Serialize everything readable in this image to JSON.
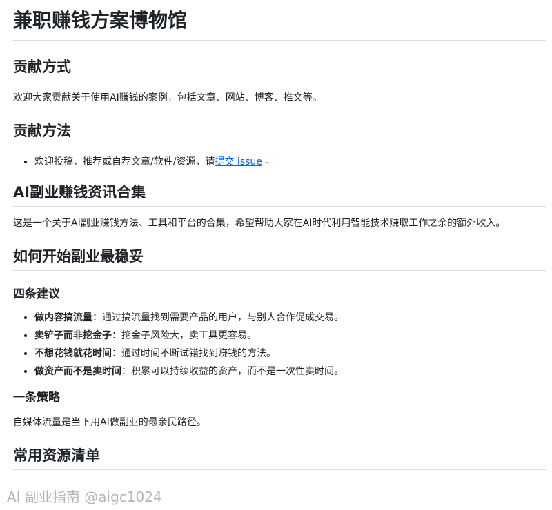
{
  "title": "兼职赚钱方案博物馆",
  "contribution_way": {
    "heading": "贡献方式",
    "text": "欢迎大家贡献关于使用AI赚钱的案例，包括文章、网站、博客、推文等。"
  },
  "contribution_method": {
    "heading": "贡献方法",
    "item_prefix": "欢迎投稿，推荐或自荐文章/软件/资源，请",
    "item_link": "提交 issue",
    "item_suffix": " 。"
  },
  "news": {
    "heading": "AI副业赚钱资讯合集",
    "text": "这是一个关于AI副业赚钱方法、工具和平台的合集，希望帮助大家在AI时代利用智能技术赚取工作之余的额外收入。"
  },
  "how_to_start": {
    "heading": "如何开始副业最稳妥",
    "four_tips": {
      "heading": "四条建议",
      "items": [
        {
          "bold": "做内容搞流量",
          "text": "：通过搞流量找到需要产品的用户，与别人合作促成交易。"
        },
        {
          "bold": "卖铲子而非挖金子",
          "text": "：挖金子风险大，卖工具更容易。"
        },
        {
          "bold": "不想花钱就花时间",
          "text": "：通过时间不断试错找到赚钱的方法。"
        },
        {
          "bold": "做资产而不是卖时间",
          "text": "：积累可以持续收益的资产，而不是一次性卖时间。"
        }
      ]
    },
    "one_strategy": {
      "heading": "一条策略",
      "text": "自媒体流量是当下用AI做副业的最亲民路径。"
    }
  },
  "resources": {
    "heading": "常用资源清单"
  },
  "watermark": "AI 副业指南 @aigc1024"
}
